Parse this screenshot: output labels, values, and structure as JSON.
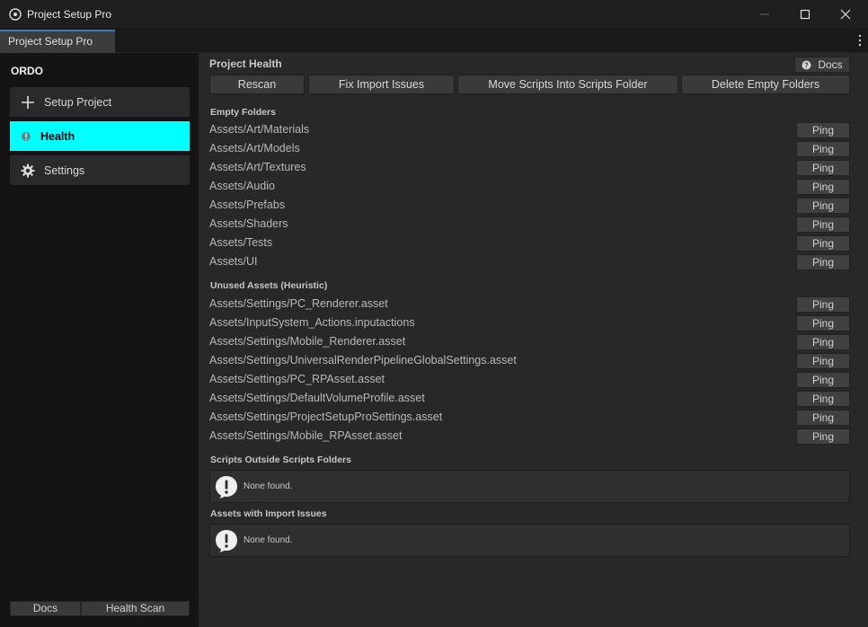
{
  "window": {
    "title": "Project Setup Pro",
    "controls": {
      "minimize": "—",
      "maximize": "☐",
      "close": "✕"
    }
  },
  "tab": {
    "label": "Project Setup Pro"
  },
  "sidebar": {
    "brand": "ORDO",
    "items": [
      {
        "label": "Setup Project",
        "icon": "plus-icon"
      },
      {
        "label": "Health",
        "icon": "info-icon",
        "active": true
      },
      {
        "label": "Settings",
        "icon": "gear-icon"
      }
    ],
    "footer": {
      "docs_label": "Docs",
      "health_scan_label": "Health Scan"
    }
  },
  "main": {
    "title": "Project Health",
    "docs_label": "Docs",
    "toolbar": {
      "rescan": "Rescan",
      "fix_import": "Fix Import Issues",
      "move_scripts": "Move Scripts Into Scripts Folder",
      "delete_empty": "Delete Empty Folders"
    },
    "ping_label": "Ping",
    "empty_folders": {
      "title": "Empty Folders",
      "items": [
        "Assets/Art/Materials",
        "Assets/Art/Models",
        "Assets/Art/Textures",
        "Assets/Audio",
        "Assets/Prefabs",
        "Assets/Shaders",
        "Assets/Tests",
        "Assets/UI"
      ]
    },
    "unused_assets": {
      "title": "Unused Assets (Heuristic)",
      "items": [
        "Assets/Settings/PC_Renderer.asset",
        "Assets/InputSystem_Actions.inputactions",
        "Assets/Settings/Mobile_Renderer.asset",
        "Assets/Settings/UniversalRenderPipelineGlobalSettings.asset",
        "Assets/Settings/PC_RPAsset.asset",
        "Assets/Settings/DefaultVolumeProfile.asset",
        "Assets/Settings/ProjectSetupProSettings.asset",
        "Assets/Settings/Mobile_RPAsset.asset"
      ]
    },
    "scripts_outside": {
      "title": "Scripts Outside Scripts Folders",
      "message": "None found."
    },
    "import_issues": {
      "title": "Assets with Import Issues",
      "message": "None found."
    }
  },
  "colors": {
    "accent_active": "#00ffff",
    "tab_highlight": "#3a79bb"
  }
}
